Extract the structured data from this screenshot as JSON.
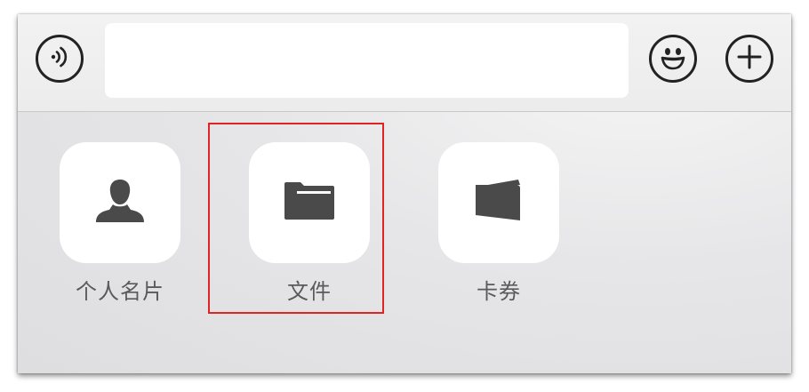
{
  "toolbar": {
    "voice_button": {
      "icon": "voice-input-icon"
    },
    "message_input": {
      "value": "",
      "placeholder": ""
    },
    "emoji_button": {
      "icon": "smiley-face-icon"
    },
    "more_button": {
      "icon": "plus-icon"
    }
  },
  "attachment_panel": {
    "items": [
      {
        "label": "个人名片",
        "icon": "person-icon"
      },
      {
        "label": "文件",
        "icon": "folder-icon"
      },
      {
        "label": "卡券",
        "icon": "card-wallet-icon"
      }
    ]
  },
  "colors": {
    "highlight_border": "#e02323",
    "icon": "#4a4a4a",
    "label": "#5a5a5a"
  }
}
